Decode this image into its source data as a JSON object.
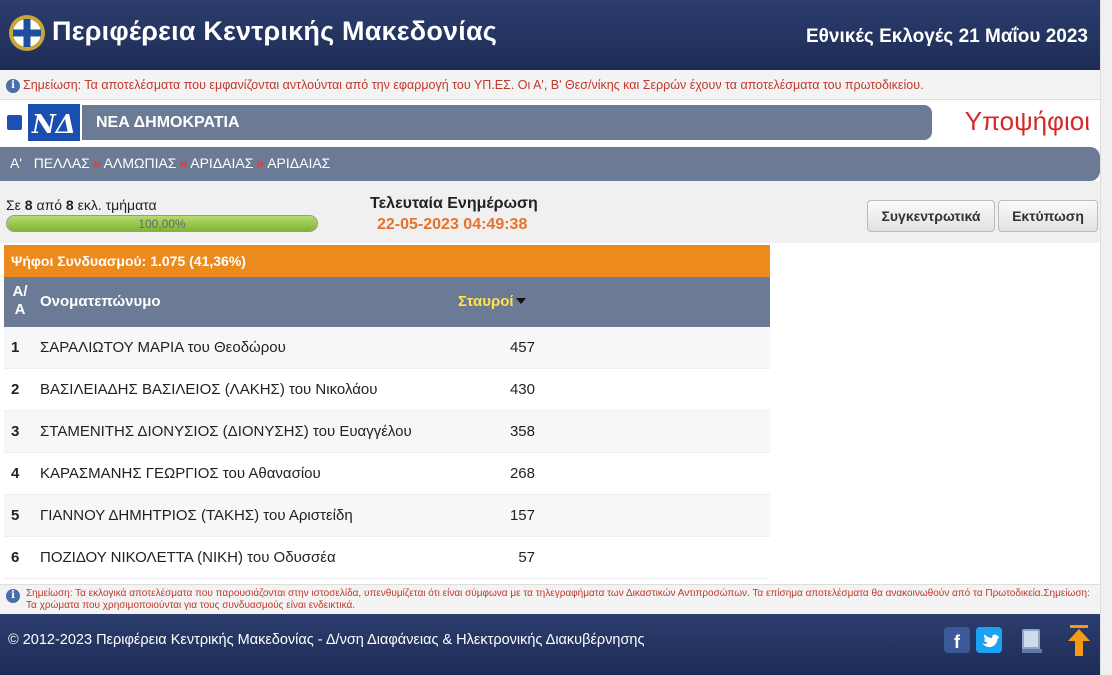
{
  "header": {
    "site_title": "Περιφέρεια Κεντρικής Μακεδονίας",
    "election_title": "Εθνικές Εκλογές 21 Μαΐου 2023"
  },
  "top_notice": "Σημείωση: Τα αποτελέσματα που εμφανίζονται αντλούνται από την εφαρμογή του ΥΠ.ΕΣ. Οι Α', Β' Θεσ/νίκης και Σερρών έχουν τα αποτελέσματα του πρωτοδικείου.",
  "party": {
    "name": "ΝΕΑ ΔΗΜΟΚΡΑΤΙΑ",
    "logo_text": "ΝΔ",
    "color": "#1f4fb5"
  },
  "candidates_title": "Υποψήφιοι",
  "breadcrumb": {
    "items": [
      "Α'",
      "ΠΕΛΛΑΣ",
      "ΑΛΜΩΠΙΑΣ",
      "ΑΡΙΔΑΙΑΣ",
      "ΑΡΙΔΑΙΑΣ"
    ],
    "separator": "»"
  },
  "status": {
    "prefix": "Σε",
    "counted": "8",
    "middle": "από",
    "total": "8",
    "suffix": "εκλ. τμήματα",
    "progress": 100,
    "progress_label": "100,00%",
    "last_update_label": "Τελευταία Ενημέρωση",
    "last_update_time": "22-05-2023 04:49:38"
  },
  "buttons": {
    "summary": "Συγκεντρωτικά",
    "print": "Εκτύπωση"
  },
  "table": {
    "votes_summary": "Ψήφοι Συνδυασμού: 1.075 (41,36%)",
    "col_aa": "Α/Α",
    "col_name": "Ονοματεπώνυμο",
    "col_crosses": "Σταυροί",
    "rows": [
      {
        "rank": "1",
        "name": "ΣΑΡΑΛΙΩΤΟΥ ΜΑΡΙΑ του Θεοδώρου",
        "votes": "457"
      },
      {
        "rank": "2",
        "name": "ΒΑΣΙΛΕΙΑΔΗΣ ΒΑΣΙΛΕΙΟΣ (ΛΑΚΗΣ) του Νικολάου",
        "votes": "430"
      },
      {
        "rank": "3",
        "name": "ΣΤΑΜΕΝΙΤΗΣ ΔΙΟΝΥΣΙΟΣ (ΔΙΟΝΥΣΗΣ) του Ευαγγέλου",
        "votes": "358"
      },
      {
        "rank": "4",
        "name": "ΚΑΡΑΣΜΑΝΗΣ ΓΕΩΡΓΙΟΣ του Αθανασίου",
        "votes": "268"
      },
      {
        "rank": "5",
        "name": "ΓΙΑΝΝΟΥ ΔΗΜΗΤΡΙΟΣ (ΤΑΚΗΣ) του Αριστείδη",
        "votes": "157"
      },
      {
        "rank": "6",
        "name": "ΠΟΖΙΔΟΥ ΝΙΚΟΛΕΤΤΑ (ΝΙΚΗ) του Οδυσσέα",
        "votes": "57"
      }
    ]
  },
  "bottom_notice": "Σημείωση: Τα εκλογικά αποτελέσματα που παρουσιάζονται στην ιστοσελίδα, υπενθυμίζεται ότι είναι σύμφωνα με τα τηλεγραφήματα των Δικαστικών Αντιπροσώπων. Τα επίσημα αποτελέσματα θα ανακοινωθούν από τα Πρωτοδικεία.Σημείωση: Τα χρώματα που χρησιμοποιούνται για τους συνδυασμούς είναι ενδεικτικά.",
  "footer": {
    "copyright": "© 2012-2023 Περιφέρεια Κεντρικής Μακεδονίας - Δ/νση Διαφάνειας & Ηλεκτρονικής Διακυβέρνησης",
    "icons": [
      "facebook-icon",
      "twitter-icon",
      "book-icon",
      "back-to-top-icon"
    ]
  },
  "colors": {
    "header_bg": "#1e2c55",
    "slate_bar": "#6b7b95",
    "orange_bar": "#ed8a1e",
    "accent_red": "#d62828",
    "time_orange": "#e8722a"
  }
}
